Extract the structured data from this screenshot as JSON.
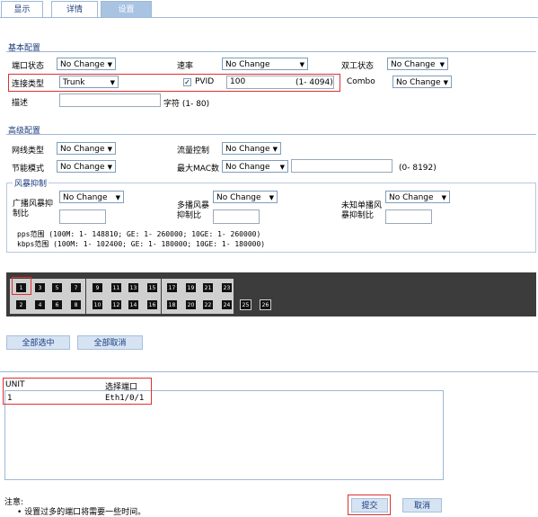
{
  "tabs": [
    "显示",
    "详情",
    "设置"
  ],
  "basic": {
    "title": "基本配置",
    "port_state_label": "端口状态",
    "port_state_value": "No Change",
    "speed_label": "速率",
    "speed_value": "No Change",
    "duplex_label": "双工状态",
    "duplex_value": "No Change",
    "link_type_label": "连接类型",
    "link_type_value": "Trunk",
    "pvid_label": "PVID",
    "pvid_value": "100",
    "pvid_range": "(1- 4094)",
    "combo_label": "Combo",
    "combo_value": "No Change",
    "desc_label": "描述",
    "desc_value": "",
    "desc_hint": "字符 (1- 80)"
  },
  "advanced": {
    "title": "高级配置",
    "net_type_label": "网线类型",
    "net_type_value": "No Change",
    "flow_ctrl_label": "流量控制",
    "flow_ctrl_value": "No Change",
    "power_save_label": "节能模式",
    "power_save_value": "No Change",
    "max_mac_label": "最大MAC数",
    "max_mac_value": "No Change",
    "max_mac_input": "",
    "max_mac_range": "(0- 8192)"
  },
  "storm": {
    "legend": "风暴抑制",
    "broadcast_label_1": "广播风暴抑",
    "broadcast_label_2": "制比",
    "broadcast_value": "No Change",
    "multicast_label_1": "多播风暴",
    "multicast_label_2": "抑制比",
    "multicast_value": "No Change",
    "unknown_label_1": "未知单播风",
    "unknown_label_2": "暴抑制比",
    "unknown_value": "No Change",
    "pps_range": "pps范围 (100M: 1- 148810; GE: 1- 260000; 10GE: 1- 260000)",
    "kbps_range": "kbps范围 (100M: 1- 102400; GE: 1- 180000; 10GE: 1- 180000)"
  },
  "ports": {
    "top": [
      "1",
      "3",
      "5",
      "7",
      "9",
      "11",
      "13",
      "15",
      "17",
      "19",
      "21",
      "23"
    ],
    "bottom": [
      "2",
      "4",
      "6",
      "8",
      "10",
      "12",
      "14",
      "16",
      "18",
      "20",
      "22",
      "24"
    ],
    "extra": [
      "25",
      "26"
    ]
  },
  "buttons": {
    "select_all": "全部选中",
    "deselect_all": "全部取消",
    "submit": "提交",
    "cancel": "取消"
  },
  "table": {
    "headers": [
      "UNIT",
      "选择端口"
    ],
    "rows": [
      [
        "1",
        "Eth1/0/1"
      ]
    ]
  },
  "notes": {
    "title": "注意:",
    "items": [
      "设置过多的端口将需要一些时间。"
    ]
  }
}
